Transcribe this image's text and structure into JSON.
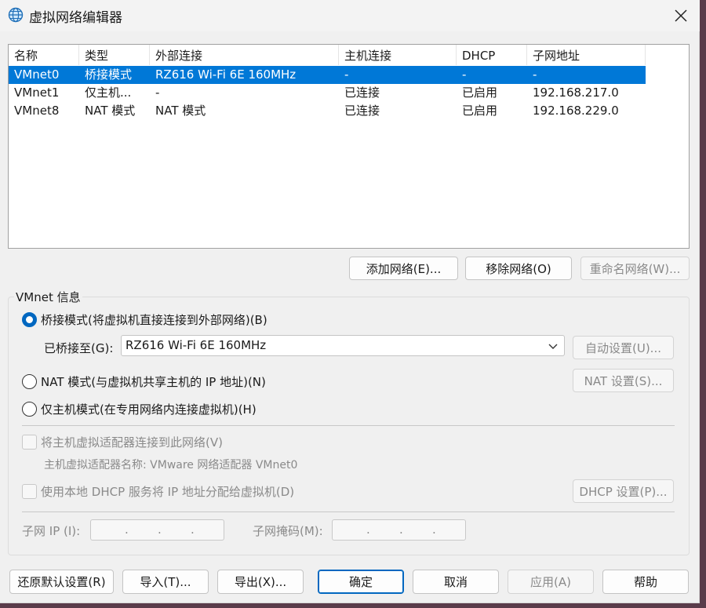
{
  "window": {
    "title": "虚拟网络编辑器",
    "app_icon": "globe-network-icon",
    "close_icon": "close-icon"
  },
  "network_list": {
    "columns": [
      "名称",
      "类型",
      "外部连接",
      "主机连接",
      "DHCP",
      "子网地址"
    ],
    "rows": [
      {
        "name": "VMnet0",
        "type": "桥接模式",
        "external": "RZ616 Wi-Fi 6E 160MHz",
        "host": "-",
        "dhcp": "-",
        "subnet": "-",
        "selected": true
      },
      {
        "name": "VMnet1",
        "type": "仅主机...",
        "external": "-",
        "host": "已连接",
        "dhcp": "已启用",
        "subnet": "192.168.217.0",
        "selected": false
      },
      {
        "name": "VMnet8",
        "type": "NAT 模式",
        "external": "NAT 模式",
        "host": "已连接",
        "dhcp": "已启用",
        "subnet": "192.168.229.0",
        "selected": false
      }
    ]
  },
  "list_buttons": {
    "add": "添加网络(E)...",
    "remove": "移除网络(O)",
    "rename": "重命名网络(W)..."
  },
  "vmnet_info": {
    "group_title": "VMnet 信息",
    "bridged_label": "桥接模式(将虚拟机直接连接到外部网络)(B)",
    "bridged_to_label": "已桥接至(G):",
    "bridged_to_value": "RZ616 Wi-Fi 6E 160MHz",
    "auto_settings": "自动设置(U)...",
    "nat_label": "NAT 模式(与虚拟机共享主机的 IP 地址)(N)",
    "nat_settings": "NAT 设置(S)...",
    "hostonly_label": "仅主机模式(在专用网络内连接虚拟机)(H)",
    "connect_adapter_label": "将主机虚拟适配器连接到此网络(V)",
    "adapter_name_label": "主机虚拟适配器名称: VMware 网络适配器 VMnet0",
    "dhcp_label": "使用本地 DHCP 服务将 IP 地址分配给虚拟机(D)",
    "dhcp_settings": "DHCP 设置(P)...",
    "subnet_ip_label": "子网 IP (I):",
    "subnet_mask_label": "子网掩码(M):",
    "ip_dot": "."
  },
  "footer": {
    "restore": "还原默认设置(R)",
    "import": "导入(T)...",
    "export": "导出(X)...",
    "ok": "确定",
    "cancel": "取消",
    "apply": "应用(A)",
    "help": "帮助"
  },
  "colors": {
    "selection": "#0078d7",
    "accent": "#0067c0",
    "disabled_text": "#8a8a8a"
  }
}
